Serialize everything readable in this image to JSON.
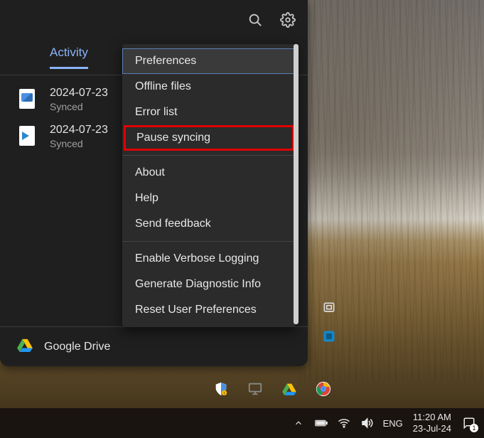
{
  "drive": {
    "tab_label": "Activity",
    "files": [
      {
        "name": "2024-07-23",
        "status": "Synced",
        "type": "image"
      },
      {
        "name": "2024-07-23",
        "status": "Synced",
        "type": "video"
      }
    ],
    "footer_title": "Google Drive"
  },
  "menu": {
    "items": [
      {
        "label": "Preferences",
        "selected": true
      },
      {
        "label": "Offline files"
      },
      {
        "label": "Error list"
      },
      {
        "label": "Pause syncing",
        "highlighted": true
      },
      {
        "sep": true
      },
      {
        "label": "About"
      },
      {
        "label": "Help"
      },
      {
        "label": "Send feedback"
      },
      {
        "sep": true
      },
      {
        "label": "Enable Verbose Logging"
      },
      {
        "label": "Generate Diagnostic Info"
      },
      {
        "label": "Reset User Preferences"
      }
    ]
  },
  "taskbar": {
    "lang": "ENG",
    "time": "11:20 AM",
    "date": "23-Jul-24",
    "notif_count": "1"
  }
}
